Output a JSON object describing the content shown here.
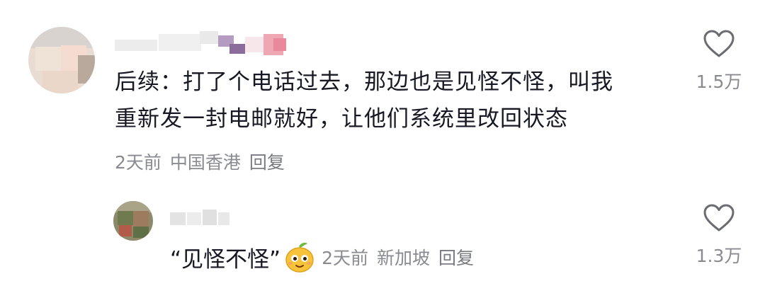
{
  "comments": [
    {
      "text_line1": "后续：打了个电话过去，那边也是见怪不怪，叫我",
      "text_line2": "重新发一封电邮就好，让他们系统里改回状态",
      "time": "2天前",
      "location": "中国香港",
      "reply_label": "回复",
      "like_count": "1.5万",
      "like_icon": "heart-outline-icon"
    },
    {
      "text": "“见怪不怪”",
      "emoji": "mango-face-emoji",
      "time": "2天前",
      "location": "新加坡",
      "reply_label": "回复",
      "like_count": "1.3万",
      "like_icon": "heart-outline-icon"
    }
  ],
  "colors": {
    "text": "#161823",
    "meta": "#8a8b91",
    "icon": "#6b6c72"
  }
}
